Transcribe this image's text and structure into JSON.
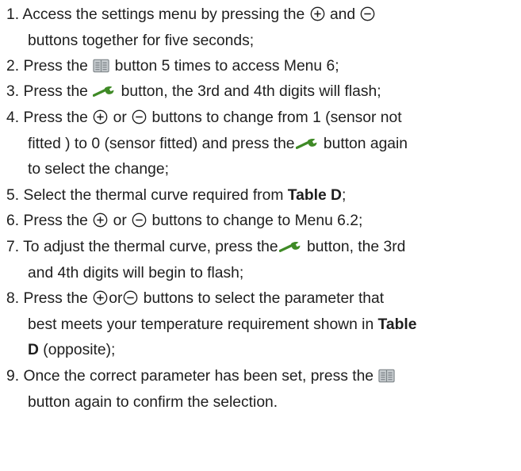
{
  "steps": [
    {
      "num": "1.",
      "a": "Access the settings menu by pressing the",
      "b": "and",
      "line2": "buttons together for five seconds;"
    },
    {
      "num": "2.",
      "a": "Press the",
      "b": "button 5 times to access Menu 6;"
    },
    {
      "num": "3.",
      "a": "Press the",
      "b": "button, the 3rd and 4th digits will flash;"
    },
    {
      "num": "4.",
      "a": "Press the",
      "b": "or",
      "c": "buttons to change from 1 (sensor not",
      "line2a": "fitted ) to 0 (sensor fitted) and press the",
      "line2b": "button again",
      "line3": "to select the change;"
    },
    {
      "num": "5.",
      "a": "Select the thermal curve required from",
      "bold": "Table D",
      "c": ";"
    },
    {
      "num": "6.",
      "a": "Press the",
      "b": "or",
      "c": "buttons to change to Menu 6.2;"
    },
    {
      "num": "7.",
      "a": "To adjust the thermal curve, press the",
      "b": "button, the 3rd",
      "line2": "and 4th digits will begin to flash;"
    },
    {
      "num": "8.",
      "a": "Press the",
      "b": "or",
      "c": "buttons to select the parameter that",
      "line2a": "best meets your temperature requirement shown in",
      "line2bold": "Table",
      "line3bold": "D",
      "line3b": "(opposite);"
    },
    {
      "num": "9.",
      "a": "Once the correct parameter has been set, press the",
      "line2": "button again to confirm the selection."
    }
  ],
  "icons": {
    "plus": "plus-circle-icon",
    "minus": "minus-circle-icon",
    "book": "book-icon",
    "wrench": "wrench-icon"
  },
  "colors": {
    "text": "#1e1e1e",
    "wrench": "#3f8a26",
    "book_fill": "#c8cdd0",
    "book_line": "#7d8488"
  }
}
